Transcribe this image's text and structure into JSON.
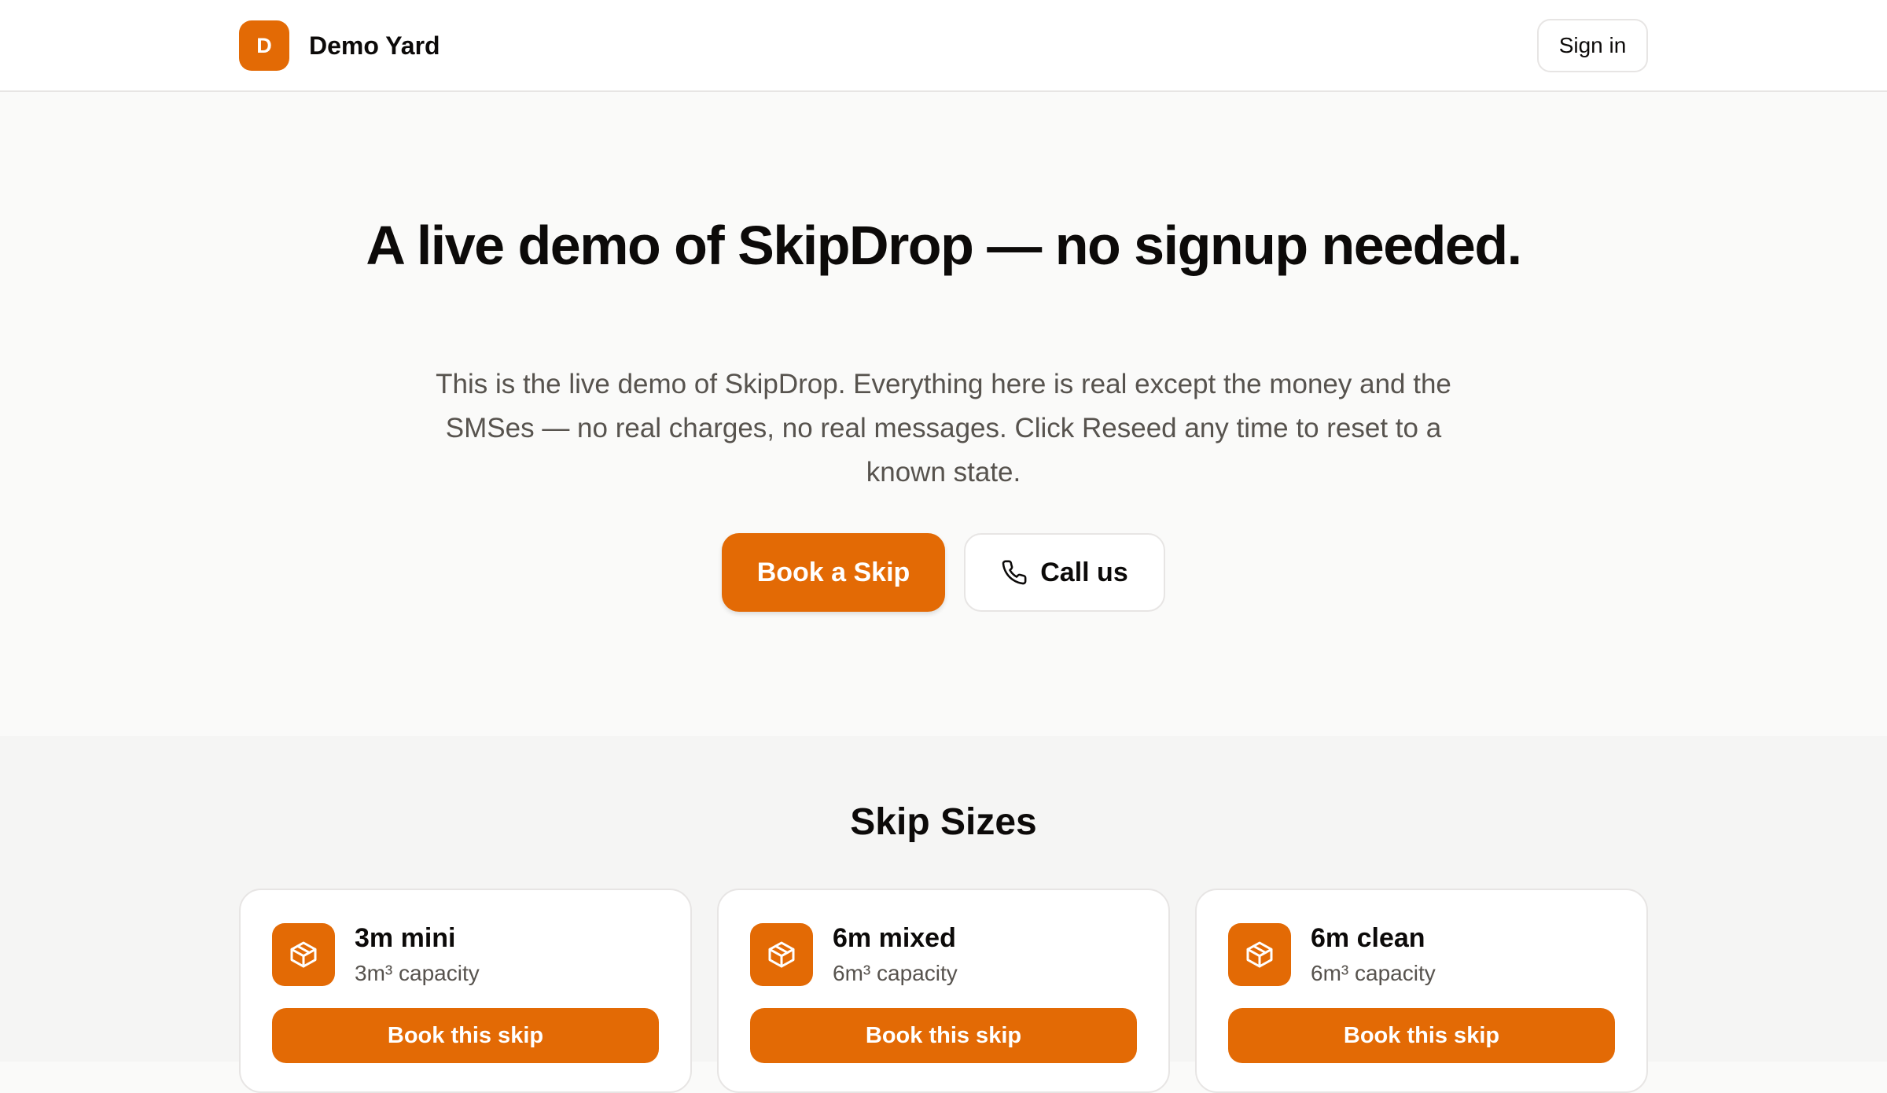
{
  "header": {
    "logo_letter": "D",
    "brand_name": "Demo Yard",
    "signin_label": "Sign in"
  },
  "hero": {
    "title": "A live demo of SkipDrop — no signup needed.",
    "subtitle": "This is the live demo of SkipDrop. Everything here is real except the money and the SMSes — no real charges, no real messages. Click Reseed any time to reset to a known state.",
    "primary_button": "Book a Skip",
    "secondary_button": "Call us",
    "secondary_icon": "phone-icon"
  },
  "sizes": {
    "title": "Skip Sizes",
    "cards": [
      {
        "name": "3m mini",
        "capacity": "3m³ capacity",
        "button": "Book this skip",
        "icon": "box-icon"
      },
      {
        "name": "6m mixed",
        "capacity": "6m³ capacity",
        "button": "Book this skip",
        "icon": "box-icon"
      },
      {
        "name": "6m clean",
        "capacity": "6m³ capacity",
        "button": "Book this skip",
        "icon": "box-icon"
      }
    ]
  },
  "colors": {
    "accent": "#e36a05",
    "background": "#fafaf9",
    "text": "#0c0a09",
    "muted_text": "#57534e"
  }
}
